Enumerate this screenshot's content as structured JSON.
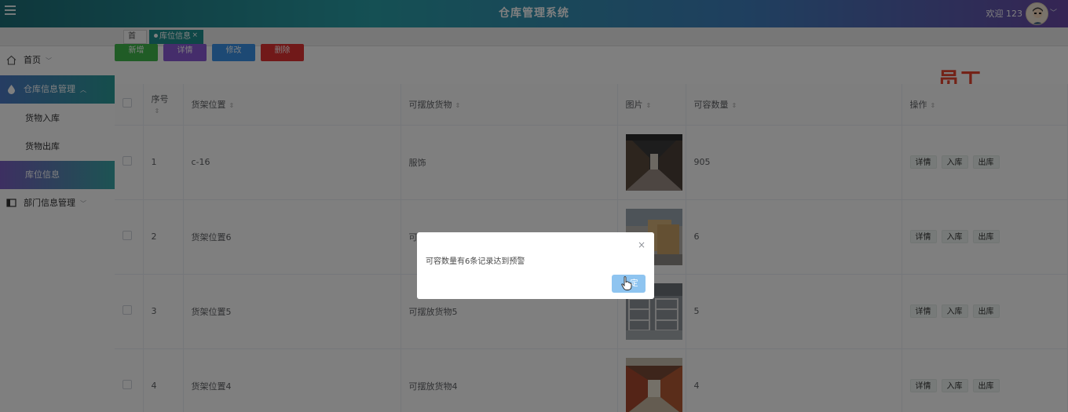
{
  "header": {
    "app_title": "仓库管理系统",
    "welcome_text": "欢迎 123",
    "menu_icon": "hamburger-icon",
    "avatar_icon": "user-avatar",
    "chevron_icon": "chevron-down-icon"
  },
  "tabs": [
    {
      "label": "首页",
      "active": false
    },
    {
      "label": "库位信息",
      "active": true,
      "close": "×"
    }
  ],
  "sidebar": {
    "items": [
      {
        "label": "首页",
        "icon": "home-icon"
      },
      {
        "label": "仓库信息管理",
        "icon": "drop-icon",
        "expanded": true,
        "children": [
          "货物入库",
          "货物出库",
          "库位信息"
        ]
      },
      {
        "label": "部门信息管理",
        "icon": "panel-icon"
      }
    ]
  },
  "toolbar": {
    "add_label": "新增",
    "detail_label": "详情",
    "edit_label": "修改",
    "delete_label": "删除",
    "colors": {
      "add": "#41b94c",
      "detail": "#8a5ad6",
      "edit": "#3b93e8",
      "delete": "#e23232"
    }
  },
  "role_label": "员工",
  "table": {
    "columns": [
      "序号",
      "货架位置",
      "可摆放货物",
      "图片",
      "可容数量",
      "操作"
    ],
    "rows": [
      {
        "index": "1",
        "shelf": "c-16",
        "goods": "服饰",
        "image": "warehouse-aisle-photo",
        "capacity": "905"
      },
      {
        "index": "2",
        "shelf": "货架位置6",
        "goods": "可",
        "image": "warehouse-boxes-photo",
        "capacity": "6"
      },
      {
        "index": "3",
        "shelf": "货架位置5",
        "goods": "可摆放货物5",
        "image": "warehouse-shelves-photo",
        "capacity": "5"
      },
      {
        "index": "4",
        "shelf": "货架位置4",
        "goods": "可摆放货物4",
        "image": "warehouse-racks-photo",
        "capacity": "4"
      }
    ],
    "row_actions": [
      "详情",
      "入库",
      "出库"
    ]
  },
  "dialog": {
    "message": "可容数量有6条记录达到预警",
    "close_icon": "×",
    "ok_label": "定"
  }
}
